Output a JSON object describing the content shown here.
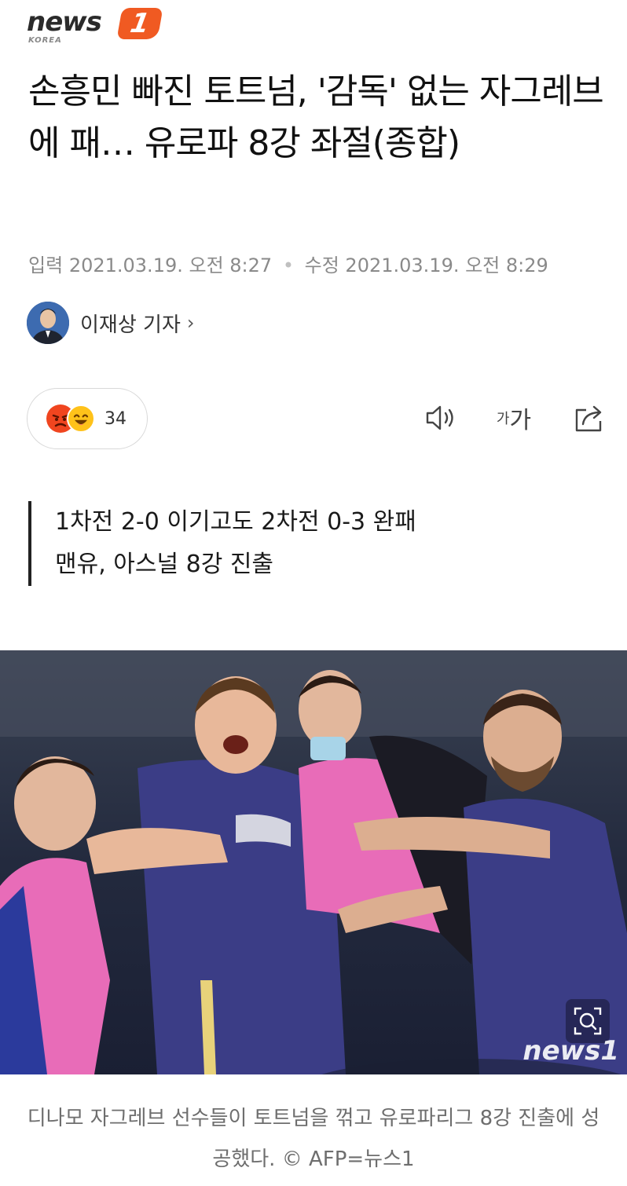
{
  "header": {
    "logo_text": "news",
    "logo_mark": "1",
    "logo_sub": "KOREA"
  },
  "article": {
    "title": "손흥민 빠진 토트넘, '감독' 없는 자그레브에 패… 유로파 8강 좌절(종합)",
    "meta": {
      "input_label": "입력",
      "input_datetime": "2021.03.19. 오전 8:27",
      "separator": "•",
      "modified_label": "수정",
      "modified_datetime": "2021.03.19. 오전 8:29"
    },
    "author": {
      "name": "이재상 기자",
      "chevron": "›"
    },
    "reactions": {
      "count": "34",
      "icons": [
        "angry-face-icon",
        "laughing-face-icon"
      ]
    },
    "tools": {
      "font_small": "가",
      "font_large": "가"
    },
    "subheadings": [
      "1차전 2-0 이기고도 2차전 0-3 완패",
      "맨유, 아스널 8강 진출"
    ],
    "photo": {
      "watermark": "news1"
    },
    "caption": "디나모 자그레브 선수들이 토트넘을 꺾고 유로파리그 8강 진출에 성공했다. © AFP=뉴스1"
  }
}
